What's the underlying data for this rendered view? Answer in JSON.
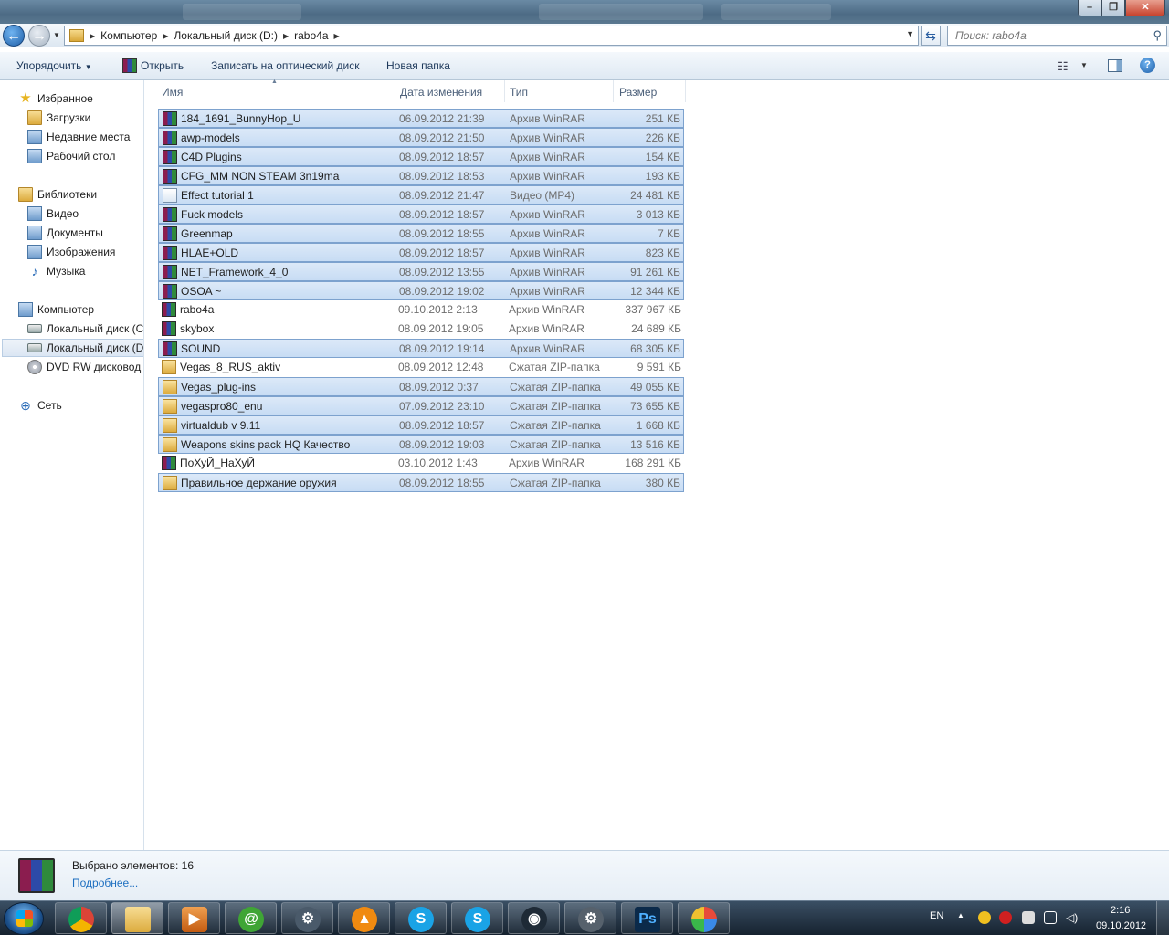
{
  "window": {
    "close_label": "✕",
    "maximize_label": "❐",
    "minimize_label": "–"
  },
  "navigation": {
    "back_icon": "back-arrow-icon",
    "forward_icon": "forward-arrow-icon",
    "breadcrumb": [
      "Компьютер",
      "Локальный диск (D:)",
      "rabo4a"
    ],
    "search_placeholder": "Поиск: rabo4a"
  },
  "toolbar": {
    "organize_label": "Упорядочить",
    "open_label": "Открыть",
    "burn_label": "Записать на оптический диск",
    "new_folder_label": "Новая папка"
  },
  "sidebar": {
    "favorites": {
      "label": "Избранное",
      "items": [
        "Загрузки",
        "Недавние места",
        "Рабочий стол"
      ]
    },
    "libraries": {
      "label": "Библиотеки",
      "items": [
        "Видео",
        "Документы",
        "Изображения",
        "Музыка"
      ]
    },
    "computer": {
      "label": "Компьютер",
      "items": [
        "Локальный диск (C:)",
        "Локальный диск (D:)",
        "DVD RW дисковод ("
      ]
    },
    "network": {
      "label": "Сеть"
    }
  },
  "columns": {
    "name": "Имя",
    "date": "Дата изменения",
    "type": "Тип",
    "size": "Размер"
  },
  "files": [
    {
      "name": "184_1691_BunnyHop_U",
      "date": "06.09.2012 21:39",
      "type": "Архив WinRAR",
      "size": "251 КБ",
      "icon": "rar",
      "selected": true
    },
    {
      "name": "awp-models",
      "date": "08.09.2012 21:50",
      "type": "Архив WinRAR",
      "size": "226 КБ",
      "icon": "rar",
      "selected": true
    },
    {
      "name": "C4D Plugins",
      "date": "08.09.2012 18:57",
      "type": "Архив WinRAR",
      "size": "154 КБ",
      "icon": "rar",
      "selected": true
    },
    {
      "name": "CFG_MM NON STEAM 3n19ma",
      "date": "08.09.2012 18:53",
      "type": "Архив WinRAR",
      "size": "193 КБ",
      "icon": "rar",
      "selected": true
    },
    {
      "name": "Effect tutorial 1",
      "date": "08.09.2012 21:47",
      "type": "Видео (MP4)",
      "size": "24 481 КБ",
      "icon": "mp4",
      "selected": true
    },
    {
      "name": "Fuck models",
      "date": "08.09.2012 18:57",
      "type": "Архив WinRAR",
      "size": "3 013 КБ",
      "icon": "rar",
      "selected": true
    },
    {
      "name": "Greenmap",
      "date": "08.09.2012 18:55",
      "type": "Архив WinRAR",
      "size": "7 КБ",
      "icon": "rar",
      "selected": true
    },
    {
      "name": "HLAE+OLD",
      "date": "08.09.2012 18:57",
      "type": "Архив WinRAR",
      "size": "823 КБ",
      "icon": "rar",
      "selected": true
    },
    {
      "name": "NET_Framework_4_0",
      "date": "08.09.2012 13:55",
      "type": "Архив WinRAR",
      "size": "91 261 КБ",
      "icon": "rar",
      "selected": true
    },
    {
      "name": "OSOA ~",
      "date": "08.09.2012 19:02",
      "type": "Архив WinRAR",
      "size": "12 344 КБ",
      "icon": "rar",
      "selected": true
    },
    {
      "name": "rabo4a",
      "date": "09.10.2012 2:13",
      "type": "Архив WinRAR",
      "size": "337 967 КБ",
      "icon": "rar",
      "selected": false
    },
    {
      "name": "skybox",
      "date": "08.09.2012 19:05",
      "type": "Архив WinRAR",
      "size": "24 689 КБ",
      "icon": "rar",
      "selected": false
    },
    {
      "name": "SOUND",
      "date": "08.09.2012 19:14",
      "type": "Архив WinRAR",
      "size": "68 305 КБ",
      "icon": "rar",
      "selected": true
    },
    {
      "name": "Vegas_8_RUS_aktiv",
      "date": "08.09.2012 12:48",
      "type": "Сжатая ZIP-папка",
      "size": "9 591 КБ",
      "icon": "zip",
      "selected": false
    },
    {
      "name": "Vegas_plug-ins",
      "date": "08.09.2012 0:37",
      "type": "Сжатая ZIP-папка",
      "size": "49 055 КБ",
      "icon": "zip",
      "selected": true
    },
    {
      "name": "vegaspro80_enu",
      "date": "07.09.2012 23:10",
      "type": "Сжатая ZIP-папка",
      "size": "73 655 КБ",
      "icon": "zip",
      "selected": true
    },
    {
      "name": "virtualdub v 9.11",
      "date": "08.09.2012 18:57",
      "type": "Сжатая ZIP-папка",
      "size": "1 668 КБ",
      "icon": "zip",
      "selected": true
    },
    {
      "name": "Weapons skins pack HQ Качество",
      "date": "08.09.2012 19:03",
      "type": "Сжатая ZIP-папка",
      "size": "13 516 КБ",
      "icon": "zip",
      "selected": true
    },
    {
      "name": "ПоХуЙ_НаХуЙ",
      "date": "03.10.2012 1:43",
      "type": "Архив WinRAR",
      "size": "168 291 КБ",
      "icon": "rar",
      "selected": false
    },
    {
      "name": "Правильное держание оружия",
      "date": "08.09.2012 18:55",
      "type": "Сжатая ZIP-папка",
      "size": "380 КБ",
      "icon": "zip",
      "selected": true
    }
  ],
  "details": {
    "selection_count": "Выбрано элементов: 16",
    "more_link": "Подробнее..."
  },
  "taskbar": {
    "apps": [
      "chrome",
      "explorer",
      "media-player",
      "mail-agent",
      "steam",
      "avast",
      "skype",
      "skype",
      "webcam",
      "settings",
      "photoshop",
      "paint"
    ],
    "ps_label": "Ps",
    "language": "EN",
    "time": "2:16",
    "date": "09.10.2012"
  }
}
